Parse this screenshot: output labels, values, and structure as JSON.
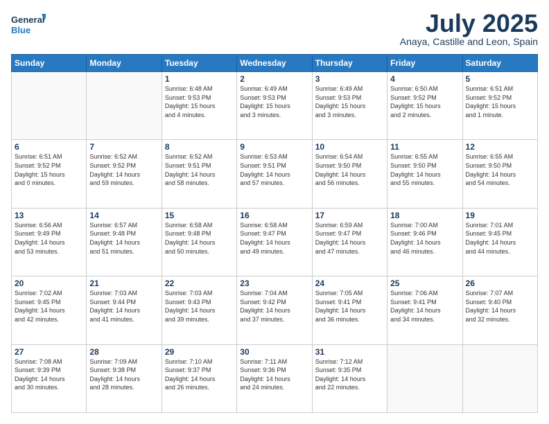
{
  "logo": {
    "line1": "General",
    "line2": "Blue"
  },
  "header": {
    "month": "July 2025",
    "location": "Anaya, Castille and Leon, Spain"
  },
  "weekdays": [
    "Sunday",
    "Monday",
    "Tuesday",
    "Wednesday",
    "Thursday",
    "Friday",
    "Saturday"
  ],
  "weeks": [
    [
      {
        "day": "",
        "detail": ""
      },
      {
        "day": "",
        "detail": ""
      },
      {
        "day": "1",
        "detail": "Sunrise: 6:48 AM\nSunset: 9:53 PM\nDaylight: 15 hours\nand 4 minutes."
      },
      {
        "day": "2",
        "detail": "Sunrise: 6:49 AM\nSunset: 9:53 PM\nDaylight: 15 hours\nand 3 minutes."
      },
      {
        "day": "3",
        "detail": "Sunrise: 6:49 AM\nSunset: 9:53 PM\nDaylight: 15 hours\nand 3 minutes."
      },
      {
        "day": "4",
        "detail": "Sunrise: 6:50 AM\nSunset: 9:52 PM\nDaylight: 15 hours\nand 2 minutes."
      },
      {
        "day": "5",
        "detail": "Sunrise: 6:51 AM\nSunset: 9:52 PM\nDaylight: 15 hours\nand 1 minute."
      }
    ],
    [
      {
        "day": "6",
        "detail": "Sunrise: 6:51 AM\nSunset: 9:52 PM\nDaylight: 15 hours\nand 0 minutes."
      },
      {
        "day": "7",
        "detail": "Sunrise: 6:52 AM\nSunset: 9:52 PM\nDaylight: 14 hours\nand 59 minutes."
      },
      {
        "day": "8",
        "detail": "Sunrise: 6:52 AM\nSunset: 9:51 PM\nDaylight: 14 hours\nand 58 minutes."
      },
      {
        "day": "9",
        "detail": "Sunrise: 6:53 AM\nSunset: 9:51 PM\nDaylight: 14 hours\nand 57 minutes."
      },
      {
        "day": "10",
        "detail": "Sunrise: 6:54 AM\nSunset: 9:50 PM\nDaylight: 14 hours\nand 56 minutes."
      },
      {
        "day": "11",
        "detail": "Sunrise: 6:55 AM\nSunset: 9:50 PM\nDaylight: 14 hours\nand 55 minutes."
      },
      {
        "day": "12",
        "detail": "Sunrise: 6:55 AM\nSunset: 9:50 PM\nDaylight: 14 hours\nand 54 minutes."
      }
    ],
    [
      {
        "day": "13",
        "detail": "Sunrise: 6:56 AM\nSunset: 9:49 PM\nDaylight: 14 hours\nand 53 minutes."
      },
      {
        "day": "14",
        "detail": "Sunrise: 6:57 AM\nSunset: 9:48 PM\nDaylight: 14 hours\nand 51 minutes."
      },
      {
        "day": "15",
        "detail": "Sunrise: 6:58 AM\nSunset: 9:48 PM\nDaylight: 14 hours\nand 50 minutes."
      },
      {
        "day": "16",
        "detail": "Sunrise: 6:58 AM\nSunset: 9:47 PM\nDaylight: 14 hours\nand 49 minutes."
      },
      {
        "day": "17",
        "detail": "Sunrise: 6:59 AM\nSunset: 9:47 PM\nDaylight: 14 hours\nand 47 minutes."
      },
      {
        "day": "18",
        "detail": "Sunrise: 7:00 AM\nSunset: 9:46 PM\nDaylight: 14 hours\nand 46 minutes."
      },
      {
        "day": "19",
        "detail": "Sunrise: 7:01 AM\nSunset: 9:45 PM\nDaylight: 14 hours\nand 44 minutes."
      }
    ],
    [
      {
        "day": "20",
        "detail": "Sunrise: 7:02 AM\nSunset: 9:45 PM\nDaylight: 14 hours\nand 42 minutes."
      },
      {
        "day": "21",
        "detail": "Sunrise: 7:03 AM\nSunset: 9:44 PM\nDaylight: 14 hours\nand 41 minutes."
      },
      {
        "day": "22",
        "detail": "Sunrise: 7:03 AM\nSunset: 9:43 PM\nDaylight: 14 hours\nand 39 minutes."
      },
      {
        "day": "23",
        "detail": "Sunrise: 7:04 AM\nSunset: 9:42 PM\nDaylight: 14 hours\nand 37 minutes."
      },
      {
        "day": "24",
        "detail": "Sunrise: 7:05 AM\nSunset: 9:41 PM\nDaylight: 14 hours\nand 36 minutes."
      },
      {
        "day": "25",
        "detail": "Sunrise: 7:06 AM\nSunset: 9:41 PM\nDaylight: 14 hours\nand 34 minutes."
      },
      {
        "day": "26",
        "detail": "Sunrise: 7:07 AM\nSunset: 9:40 PM\nDaylight: 14 hours\nand 32 minutes."
      }
    ],
    [
      {
        "day": "27",
        "detail": "Sunrise: 7:08 AM\nSunset: 9:39 PM\nDaylight: 14 hours\nand 30 minutes."
      },
      {
        "day": "28",
        "detail": "Sunrise: 7:09 AM\nSunset: 9:38 PM\nDaylight: 14 hours\nand 28 minutes."
      },
      {
        "day": "29",
        "detail": "Sunrise: 7:10 AM\nSunset: 9:37 PM\nDaylight: 14 hours\nand 26 minutes."
      },
      {
        "day": "30",
        "detail": "Sunrise: 7:11 AM\nSunset: 9:36 PM\nDaylight: 14 hours\nand 24 minutes."
      },
      {
        "day": "31",
        "detail": "Sunrise: 7:12 AM\nSunset: 9:35 PM\nDaylight: 14 hours\nand 22 minutes."
      },
      {
        "day": "",
        "detail": ""
      },
      {
        "day": "",
        "detail": ""
      }
    ]
  ]
}
